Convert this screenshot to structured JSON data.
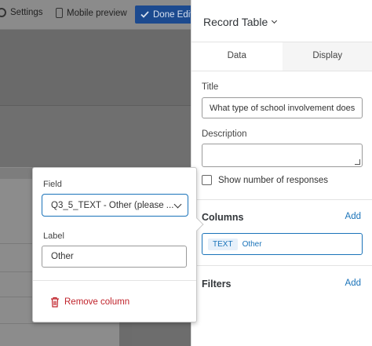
{
  "topbar": {
    "settings_label": "Settings",
    "mobile_preview_label": "Mobile preview",
    "done_label": "Done Editing"
  },
  "popover": {
    "field_label": "Field",
    "field_value": "Q3_5_TEXT - Other (please ...",
    "label_label": "Label",
    "label_value": "Other",
    "remove_column_label": "Remove column"
  },
  "panel": {
    "title": "Record Table",
    "tabs": [
      "Data",
      "Display"
    ],
    "title_label": "Title",
    "title_value": "What type of school involvement does",
    "description_label": "Description",
    "description_value": "",
    "show_responses_label": "Show number of responses",
    "columns_label": "Columns",
    "columns_add": "Add",
    "column_tag": "TEXT",
    "column_name": "Other",
    "filters_label": "Filters",
    "filters_add": "Add"
  },
  "colors": {
    "accent": "#1a73b9",
    "danger": "#c0232b",
    "done_button": "#1c4a8f"
  }
}
